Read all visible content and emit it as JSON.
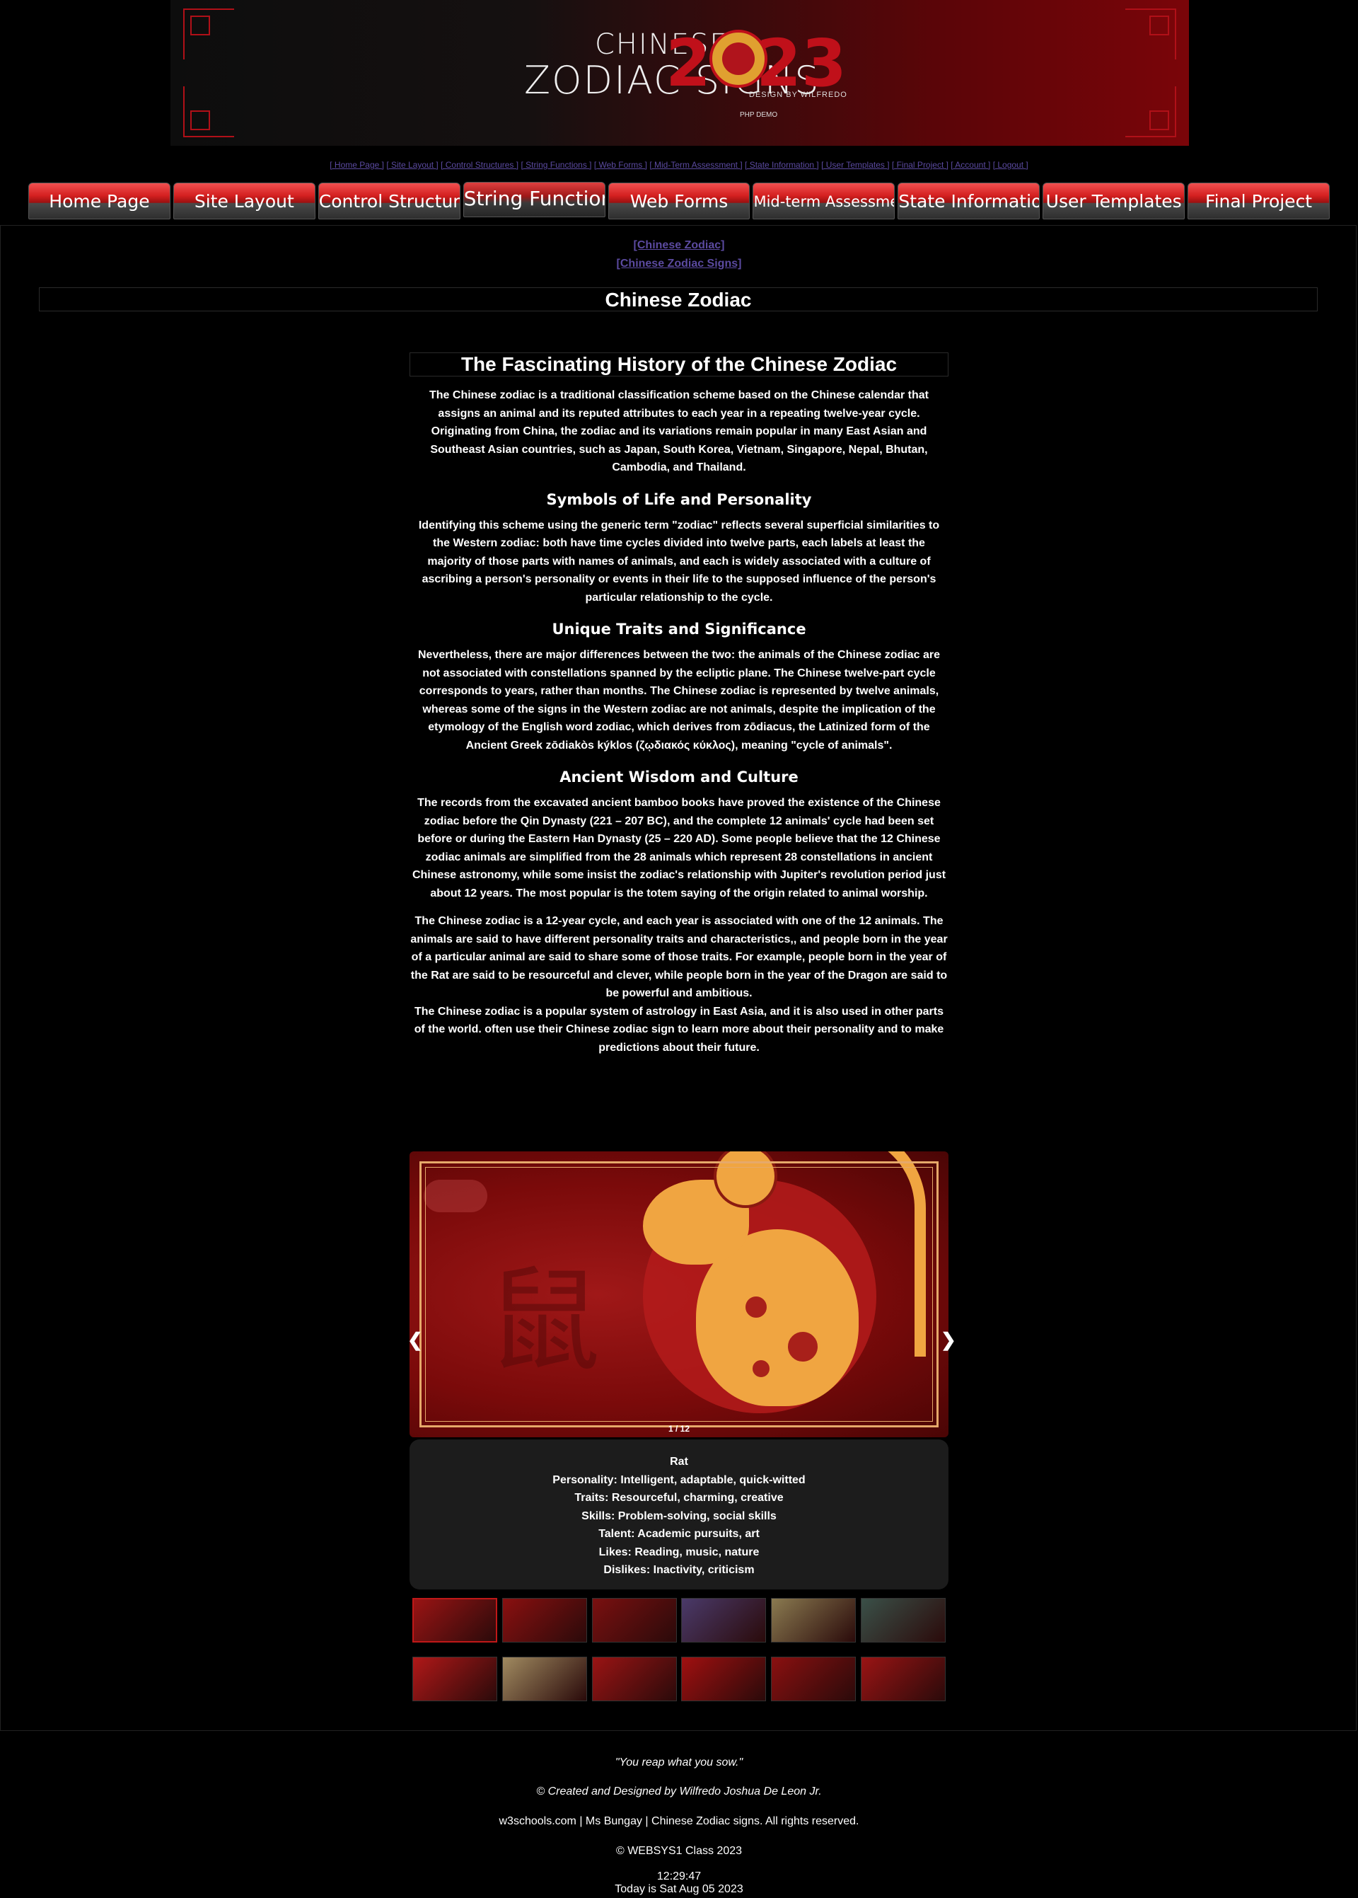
{
  "banner": {
    "line1": "CHINESE",
    "line2": "ZODIAC SIGNS",
    "year": "2023",
    "design_by": "DESIGN BY WILFREDO",
    "demo": "PHP DEMO"
  },
  "text_links": [
    "[ Home Page ]",
    "[ Site Layout ]",
    "[ Control Structures ]",
    "[ String Functions ]",
    "[ Web Forms ]",
    "[ Mid-Term Assessment ]",
    "[ State Information ]",
    "[ User Templates ]",
    "[ Final Project ]",
    "[ Account ]",
    "[ Logout ]"
  ],
  "tabs": [
    "Home Page",
    "Site Layout",
    "Control Structure",
    "String Function",
    "Web Forms",
    "Mid-term Assessment",
    "State Information",
    "User Templates",
    "Final Project"
  ],
  "links": {
    "chinese_zodiac": "[Chinese Zodiac]",
    "chinese_zodiac_signs": "[Chinese Zodiac Signs]"
  },
  "page_title": "Chinese Zodiac",
  "article": {
    "heading": "The Fascinating History of the Chinese Zodiac",
    "intro": "The Chinese zodiac is a traditional classification scheme based on the Chinese calendar that assigns an animal and its reputed attributes to each year in a repeating twelve-year cycle. Originating from China, the zodiac and its variations remain popular in many East Asian and Southeast Asian countries, such as Japan, South Korea, Vietnam, Singapore, Nepal, Bhutan, Cambodia, and Thailand.",
    "sections": [
      {
        "title": "Symbols of Life and Personality",
        "text": "Identifying this scheme using the generic term \"zodiac\" reflects several superficial similarities to the Western zodiac: both have time cycles divided into twelve parts, each labels at least the majority of those parts with names of animals, and each is widely associated with a culture of ascribing a person's personality or events in their life to the supposed influence of the person's particular relationship to the cycle."
      },
      {
        "title": "Unique Traits and Significance",
        "text": "Nevertheless, there are major differences between the two: the animals of the Chinese zodiac are not associated with constellations spanned by the ecliptic plane. The Chinese twelve-part cycle corresponds to years, rather than months. The Chinese zodiac is represented by twelve animals, whereas some of the signs in the Western zodiac are not animals, despite the implication of the etymology of the English word zodiac, which derives from zōdiacus, the Latinized form of the Ancient Greek zōdiakòs kýklos (ζῳδιακός κύκλος), meaning \"cycle of animals\"."
      },
      {
        "title": "Ancient Wisdom and Culture",
        "text": "The records from the excavated ancient bamboo books have proved the existence of the Chinese zodiac before the Qin Dynasty (221 – 207 BC), and the complete 12 animals' cycle had been set before or during the Eastern Han Dynasty (25 – 220 AD). Some people believe that the 12 Chinese zodiac animals are simplified from the 28 animals which represent 28 constellations in ancient Chinese astronomy, while some insist the zodiac's relationship with Jupiter's revolution period just about 12 years. The most popular is the totem saying of the origin related to animal worship."
      }
    ],
    "para_cycle": "The Chinese zodiac is a 12-year cycle, and each year is associated with one of the 12 animals. The animals are said to have different personality traits and characteristics,, and people born in the year of a particular animal are said to share some of those traits. For example, people born in the year of the Rat are said to be resourceful and clever, while people born in the year of the Dragon are said to be powerful and ambitious.",
    "para_popular": "The Chinese zodiac is a popular system of astrology in East Asia, and it is also used in other parts of the world. often use their Chinese zodiac sign to learn more about their personality and to make predictions about their future."
  },
  "slideshow": {
    "prev": "❮",
    "next": "❯",
    "counter": "1 / 12",
    "watermark_char": "鼠",
    "caption": {
      "animal": "Rat",
      "personality": "Personality: Intelligent, adaptable, quick-witted",
      "traits": "Traits: Resourceful, charming, creative",
      "skills": "Skills: Problem-solving, social skills",
      "talent": "Talent: Academic pursuits, art",
      "likes": "Likes: Reading, music, nature",
      "dislikes": "Dislikes: Inactivity, criticism"
    },
    "thumb_colors": [
      "#9a1414",
      "#8a1010",
      "#7a1010",
      "#4a3a6a",
      "#8a7a50",
      "#3a5048",
      "#b01818",
      "#a08a60",
      "#9a1414",
      "#a01010",
      "#8a1010",
      "#9a1414"
    ]
  },
  "footer": {
    "quote": "\"You reap what you sow.\"",
    "credit": "© Created and Designed by Wilfredo Joshua De Leon Jr.",
    "rights": "w3schools.com | Ms Bungay | Chinese Zodiac signs. All rights reserved.",
    "class": "© WEBSYS1 Class 2023",
    "time": "12:29:47",
    "date": "Today is Sat Aug 05 2023"
  }
}
